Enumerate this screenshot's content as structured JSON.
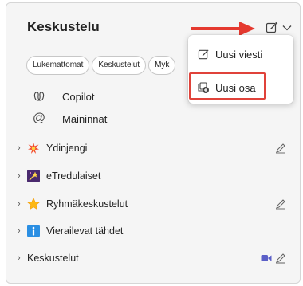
{
  "header": {
    "title": "Keskustelu"
  },
  "filters": [
    "Lukemattomat",
    "Keskustelut",
    "Myk"
  ],
  "nav": [
    {
      "label": "Copilot",
      "icon": "copilot-icon"
    },
    {
      "label": "Maininnat",
      "icon": "at-icon"
    }
  ],
  "groups": [
    {
      "label": "Ydinjengi",
      "icon": "explosion-emoji-icon",
      "action": "compose-icon"
    },
    {
      "label": "eTredulaiset",
      "icon": "stars-emoji-icon",
      "action": ""
    },
    {
      "label": "Ryhmäkeskustelut",
      "icon": "star-emoji-icon",
      "action": "compose-icon"
    },
    {
      "label": "Vierailevat tähdet",
      "icon": "info-emoji-icon",
      "action": ""
    },
    {
      "label": "Keskustelut",
      "icon": "",
      "action": "compose-icon",
      "extra": "video-icon"
    }
  ],
  "menu": {
    "items": [
      {
        "label": "Uusi viesti",
        "icon": "compose-icon"
      },
      {
        "label": "Uusi osa",
        "icon": "new-section-icon"
      }
    ]
  },
  "colors": {
    "arrow": "#e5392f",
    "highlight": "#e0423a",
    "video": "#5b5fc7"
  }
}
